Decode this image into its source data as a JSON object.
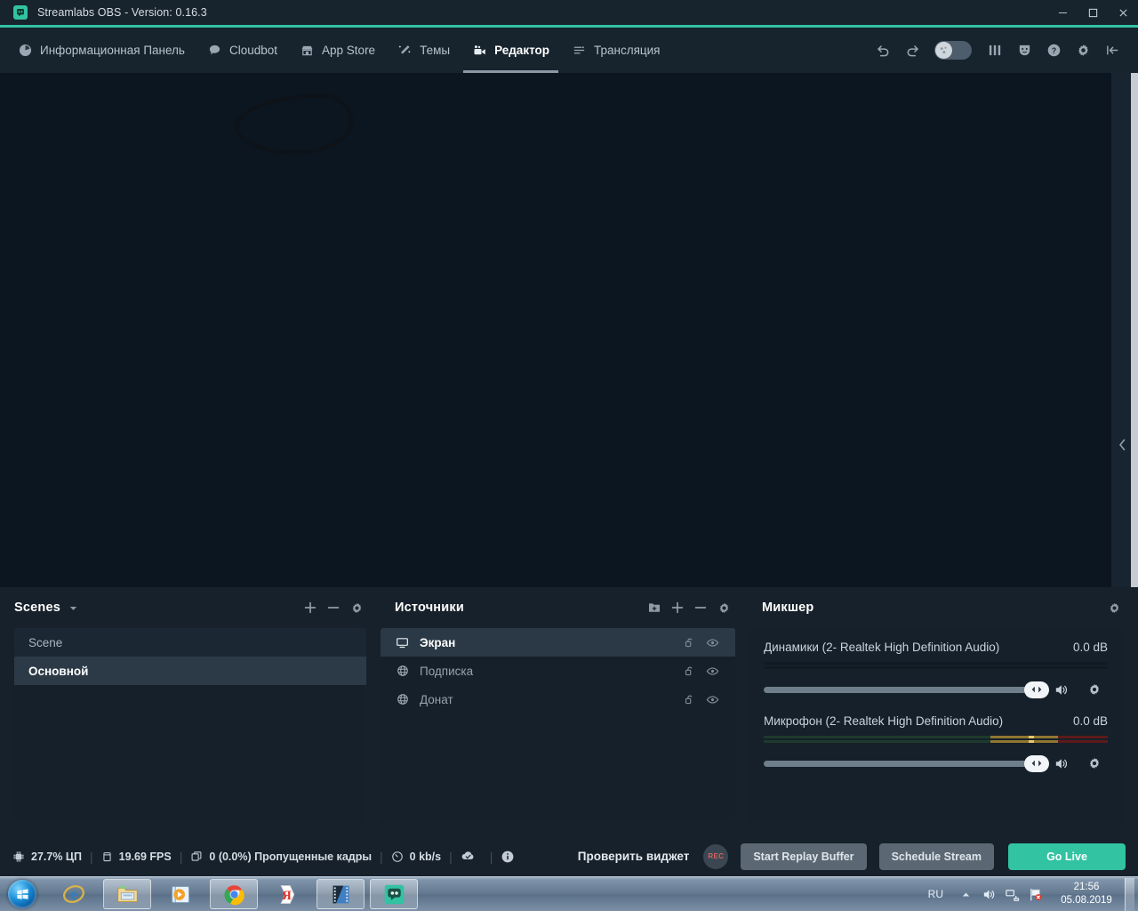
{
  "window": {
    "title": "Streamlabs OBS - Version: 0.16.3",
    "app_icon": "streamlabs-logo-icon",
    "minimize_label": "─",
    "maximize_label": "□",
    "close_label": "×",
    "accent_color": "#31c3a2"
  },
  "nav": {
    "items": [
      {
        "label": "Информационная Панель",
        "icon": "dashboard-icon",
        "active": false
      },
      {
        "label": "Cloudbot",
        "icon": "chat-bubble-icon",
        "active": false
      },
      {
        "label": "App Store",
        "icon": "store-icon",
        "active": false
      },
      {
        "label": "Темы",
        "icon": "magic-wand-icon",
        "active": false
      },
      {
        "label": "Редактор",
        "icon": "video-camera-icon",
        "active": true
      },
      {
        "label": "Трансляция",
        "icon": "sliders-icon",
        "active": false
      }
    ],
    "tools": [
      {
        "name": "undo-icon"
      },
      {
        "name": "redo-icon"
      },
      {
        "name": "night-mode-toggle"
      },
      {
        "name": "layout-editor-icon"
      },
      {
        "name": "theater-masks-icon"
      },
      {
        "name": "help-icon"
      },
      {
        "name": "settings-gear-icon"
      },
      {
        "name": "collapse-panel-icon"
      }
    ]
  },
  "preview": {
    "annotation": "hand-drawn-oval-annotation",
    "expand_chevron": "‹"
  },
  "scenes": {
    "title": "Scenes",
    "caret": "▾",
    "tools": [
      "add-scene-icon",
      "remove-scene-icon",
      "scene-settings-icon"
    ],
    "items": [
      {
        "label": "Scene",
        "selected": false
      },
      {
        "label": "Основной",
        "selected": true
      }
    ]
  },
  "sources": {
    "title": "Источники",
    "tools": [
      "add-folder-icon",
      "add-source-icon",
      "remove-source-icon",
      "source-settings-icon"
    ],
    "items": [
      {
        "label": "Экран",
        "icon": "monitor-icon",
        "selected": true,
        "lock": "unlock-icon",
        "visibility": "eye-icon"
      },
      {
        "label": "Подписка",
        "icon": "globe-icon",
        "selected": false,
        "lock": "unlock-icon",
        "visibility": "eye-icon"
      },
      {
        "label": "Донат",
        "icon": "globe-icon",
        "selected": false,
        "lock": "unlock-icon",
        "visibility": "eye-icon"
      }
    ]
  },
  "mixer": {
    "title": "Микшер",
    "settings_icon": "mixer-settings-icon",
    "channels": [
      {
        "name": "Динамики (2- Realtek High Definition Audio)",
        "db": "0.0 dB",
        "volume_percent": 100,
        "meter_level_percent": 0,
        "mute_icon": "speaker-icon",
        "settings_icon": "channel-settings-icon"
      },
      {
        "name": "Микрофон (2- Realtek High Definition Audio)",
        "db": "0.0 dB",
        "volume_percent": 100,
        "meter_level_percent": 62,
        "mute_icon": "speaker-icon",
        "settings_icon": "channel-settings-icon"
      }
    ],
    "meter_colors": {
      "green": "#1d3a2c",
      "yellow": "#c5a04a",
      "red": "#5d1a1a",
      "peak": "#e8c86a"
    }
  },
  "status": {
    "cpu": "27.7% ЦП",
    "cpu_icon": "cpu-icon",
    "fps": "19.69 FPS",
    "fps_icon": "fps-icon",
    "dropped": "0 (0.0%) Пропущенные кадры",
    "dropped_icon": "frames-icon",
    "bitrate": "0 kb/s",
    "bitrate_icon": "bitrate-icon",
    "cloud_icon": "cloud-check-icon",
    "info_icon": "info-icon",
    "separator": "|"
  },
  "actions": {
    "check_widget": "Проверить виджет",
    "rec_label": "REC",
    "replay_buffer": "Start Replay Buffer",
    "schedule_stream": "Schedule Stream",
    "go_live": "Go Live",
    "go_live_color": "#31c3a2"
  },
  "taskbar": {
    "start_icon": "windows-start-orb",
    "apps": [
      {
        "name": "internet-explorer-icon",
        "framed": false
      },
      {
        "name": "file-explorer-icon",
        "framed": true
      },
      {
        "name": "windows-media-player-icon",
        "framed": false
      },
      {
        "name": "google-chrome-icon",
        "framed": true
      },
      {
        "name": "yandex-browser-icon",
        "framed": false
      },
      {
        "name": "movie-maker-icon",
        "framed": true
      },
      {
        "name": "streamlabs-obs-icon",
        "framed": true
      }
    ],
    "tray": {
      "language": "RU",
      "show_hidden_icon": "chevron-up-icon",
      "volume_icon": "volume-icon",
      "network_icon": "network-icon",
      "action_center_icon": "flag-alert-icon",
      "time": "21:56",
      "date": "05.08.2019"
    }
  }
}
